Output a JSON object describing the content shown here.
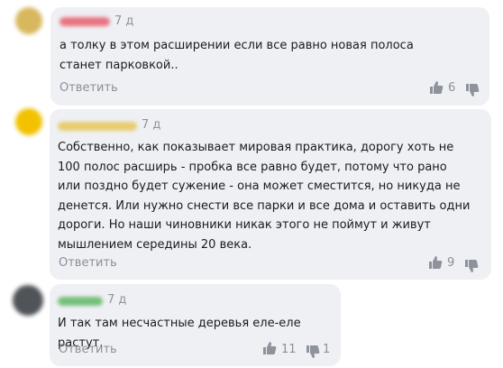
{
  "comments": [
    {
      "author": "",
      "time": "7 д",
      "text": "а толку в этом расширении если все равно новая полоса станет парковкой..",
      "reply_label": "Ответить",
      "likes": "6",
      "dislikes": "",
      "avatar_color": "#d8b85e",
      "name_color": "#e64a5a"
    },
    {
      "author": "",
      "time": "7 д",
      "text": "Собственно, как показывает мировая практика, дорогу хоть не 100 полос расширь - пробка все равно будет, потому что рано или поздно будет сужение - она может сместится, но никуда не денется. Или нужно снести все парки и все дома и оставить одни дороги. Но наши чиновники никак этого не поймут и живут мышлением середины 20 века.",
      "reply_label": "Ответить",
      "likes": "9",
      "dislikes": "",
      "avatar_color": "#f2c200",
      "name_color": "#e6c040"
    },
    {
      "author": "",
      "time": "7 д",
      "text": "И так там несчастные деревья еле-еле растут.",
      "reply_label": "Ответить",
      "likes": "11",
      "dislikes": "1",
      "avatar_color": "#505458",
      "name_color": "#4caf50"
    }
  ],
  "icons": {
    "like": "thumb-up-icon",
    "dislike": "thumb-down-icon"
  }
}
